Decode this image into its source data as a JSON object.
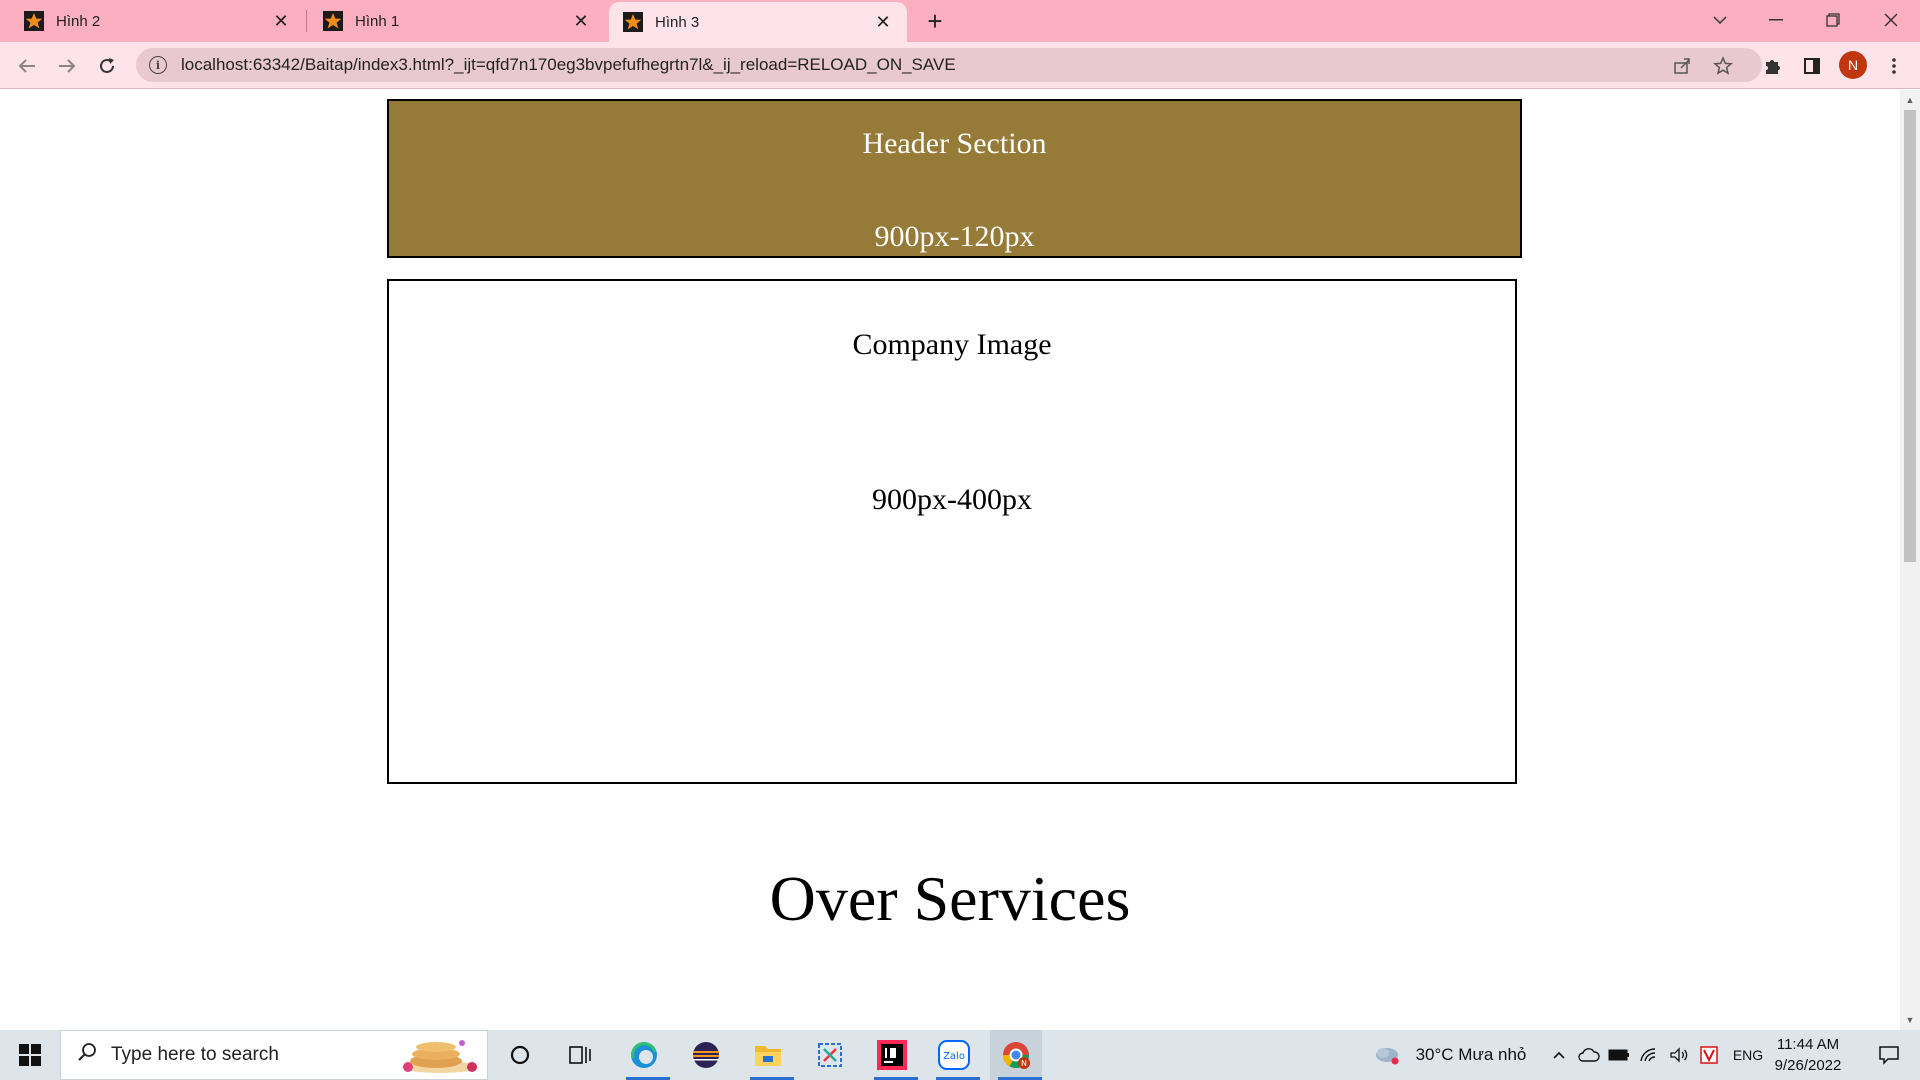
{
  "browser": {
    "tabs": [
      {
        "label": "Hình 2",
        "active": false
      },
      {
        "label": "Hình 1",
        "active": false
      },
      {
        "label": "Hình 3",
        "active": true
      }
    ],
    "url": "localhost:63342/Baitap/index3.html?_ijt=qfd7n170eg3bvpefufhegrtn7l&_ij_reload=RELOAD_ON_SAVE",
    "profile_initial": "N"
  },
  "page": {
    "header": {
      "title": "Header Section",
      "size": "900px-120px",
      "bg_color": "#967a37"
    },
    "image": {
      "title": "Company Image",
      "size": "900px-400px"
    },
    "services_heading": "Over Services"
  },
  "taskbar": {
    "search_placeholder": "Type here to search",
    "weather": "30°C Mưa nhỏ",
    "language": "ENG",
    "time": "11:44 AM",
    "date": "9/26/2022"
  }
}
